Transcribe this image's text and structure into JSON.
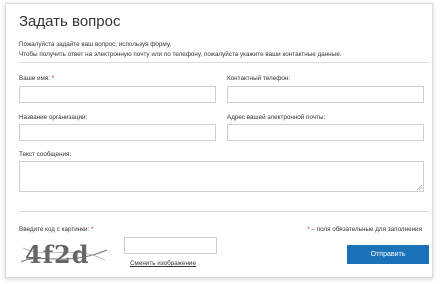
{
  "form": {
    "title": "Задать вопрос",
    "intro_line1": "Пожалуйста задайте ваш вопрос, используя форму.",
    "intro_line2": "Чтобы получить ответ на электронную почту или по телефону, пожалуйста укажите ваши контактные данные.",
    "name_label": "Ваше имя:",
    "phone_label": "Контактный телефон:",
    "org_label": "Название организации:",
    "email_label": "Адрес вашей электронной почты:",
    "message_label": "Текст сообщения:",
    "captcha_label": "Введите код с картинки:",
    "required_mark": "*",
    "required_hint": " – поля обязательные для заполнения",
    "captcha_text": "4f2d",
    "change_image_link": "Сменить изображение",
    "submit_label": "Отправить",
    "name_value": "",
    "phone_value": "",
    "org_value": "",
    "email_value": "",
    "message_value": "",
    "captcha_value": ""
  },
  "colors": {
    "accent": "#1a73b8",
    "required": "#e30613",
    "border": "#cfcfcf"
  }
}
